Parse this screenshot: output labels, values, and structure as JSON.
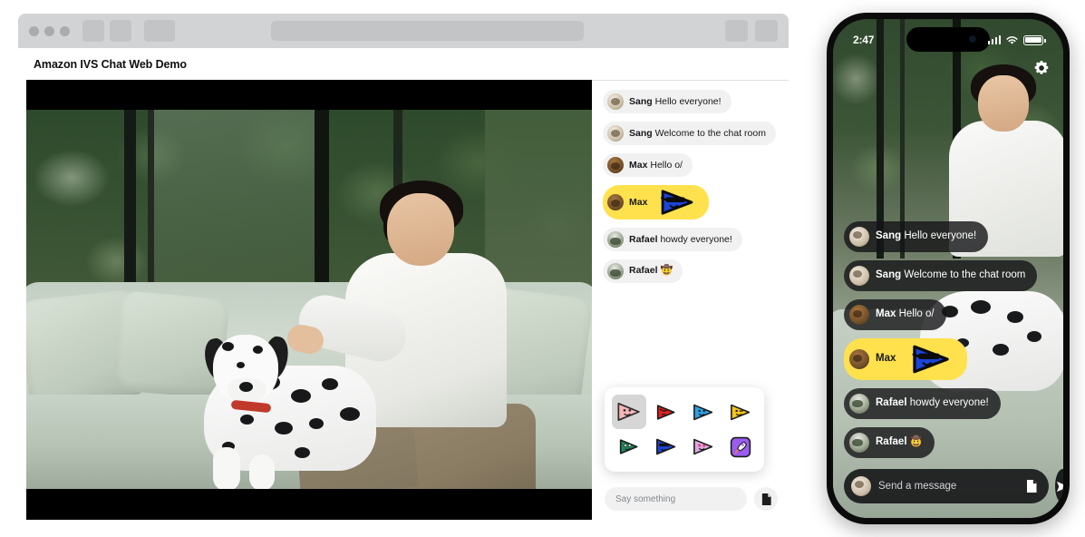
{
  "browser": {
    "window_controls": [
      "close",
      "minimize",
      "maximize"
    ],
    "page_title": "Amazon IVS Chat Web Demo",
    "url_value": ""
  },
  "colors": {
    "sticker_highlight": "#ffe14d",
    "bubble_desktop": "#f1f1f1",
    "bubble_mobile": "rgba(20,20,22,0.80)",
    "chrome": "#d2d3d4"
  },
  "desktop_chat": {
    "messages": [
      {
        "user": "Sang",
        "text": "Hello everyone!",
        "avatar": "av-sang",
        "type": "text"
      },
      {
        "user": "Sang",
        "text": "Welcome to the chat room",
        "avatar": "av-sang",
        "type": "text"
      },
      {
        "user": "Max",
        "text": "Hello o/",
        "avatar": "av-max",
        "type": "text"
      },
      {
        "user": "Max",
        "text": "",
        "avatar": "av-max",
        "type": "sticker",
        "sticker": "blue-sunglasses-play"
      },
      {
        "user": "Rafael",
        "text": "howdy everyone!",
        "avatar": "av-rafael",
        "type": "text"
      },
      {
        "user": "Rafael",
        "text": "🤠",
        "avatar": "av-rafael",
        "type": "emoji"
      }
    ],
    "composer": {
      "placeholder": "Say something",
      "value": "",
      "attach_button_icon": "sticker-document-icon"
    },
    "sticker_picker": {
      "visible": true,
      "selected_index": 0,
      "stickers": [
        {
          "name": "pink-smile-play",
          "fill": "#f6b6b6",
          "selected": true
        },
        {
          "name": "red-angry-play",
          "fill": "#e02020",
          "selected": false
        },
        {
          "name": "blue-happy-play",
          "fill": "#2f9fe0",
          "selected": false
        },
        {
          "name": "yellow-wink-play",
          "fill": "#f5c21b",
          "selected": false
        },
        {
          "name": "green-money-play",
          "fill": "#1f8a5a",
          "selected": false
        },
        {
          "name": "blue-sunglasses-play",
          "fill": "#1b44d8",
          "selected": false
        },
        {
          "name": "pink-hearts-play",
          "fill": "#d9a7e0",
          "selected": false
        },
        {
          "name": "purple-rocket",
          "fill": "#9a5cf0",
          "selected": false
        }
      ]
    }
  },
  "phone": {
    "status_bar": {
      "time": "2:47",
      "signal_icon": "cellular-bars-icon",
      "wifi_icon": "wifi-icon",
      "battery_icon": "battery-full-icon"
    },
    "settings_button_icon": "gear-icon",
    "messages": [
      {
        "user": "Sang",
        "text": "Hello everyone!",
        "avatar": "av-sang",
        "type": "text"
      },
      {
        "user": "Sang",
        "text": "Welcome to the chat room",
        "avatar": "av-sang",
        "type": "text"
      },
      {
        "user": "Max",
        "text": "Hello o/",
        "avatar": "av-max",
        "type": "text"
      },
      {
        "user": "Max",
        "text": "",
        "avatar": "av-max",
        "type": "sticker",
        "sticker": "blue-sunglasses-play"
      },
      {
        "user": "Rafael",
        "text": "howdy everyone!",
        "avatar": "av-rafael",
        "type": "text"
      },
      {
        "user": "Rafael",
        "text": "🤠",
        "avatar": "av-rafael",
        "type": "emoji"
      }
    ],
    "composer": {
      "placeholder": "Send a message",
      "value": "",
      "avatar": "av-sang",
      "attach_button_icon": "sticker-document-icon",
      "send_button_icon": "send-arrow-icon"
    }
  }
}
